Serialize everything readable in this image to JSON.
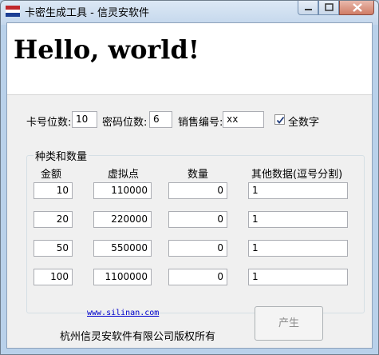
{
  "window": {
    "title": "卡密生成工具 - 信灵安软件"
  },
  "banner": {
    "text": "Hello, world!"
  },
  "settings": {
    "card_digits_label": "卡号位数:",
    "card_digits_value": "10",
    "pwd_digits_label": "密码位数:",
    "pwd_digits_value": "6",
    "sales_code_label": "销售编号:",
    "sales_code_value": "xx",
    "all_digits_label": "全数字",
    "all_digits_checked": true
  },
  "group": {
    "title": "种类和数量",
    "headers": [
      "金额",
      "虚拟点",
      "数量",
      "其他数据(逗号分割)"
    ],
    "rows": [
      {
        "amount": "10",
        "points": "110000",
        "quantity": "0",
        "other": "1"
      },
      {
        "amount": "20",
        "points": "220000",
        "quantity": "0",
        "other": "1"
      },
      {
        "amount": "50",
        "points": "550000",
        "quantity": "0",
        "other": "1"
      },
      {
        "amount": "100",
        "points": "1100000",
        "quantity": "0",
        "other": "1"
      }
    ]
  },
  "footer": {
    "link": "www.silinan.com",
    "copyright": "杭州信灵安软件有限公司版权所有",
    "generate_label": "产生"
  }
}
